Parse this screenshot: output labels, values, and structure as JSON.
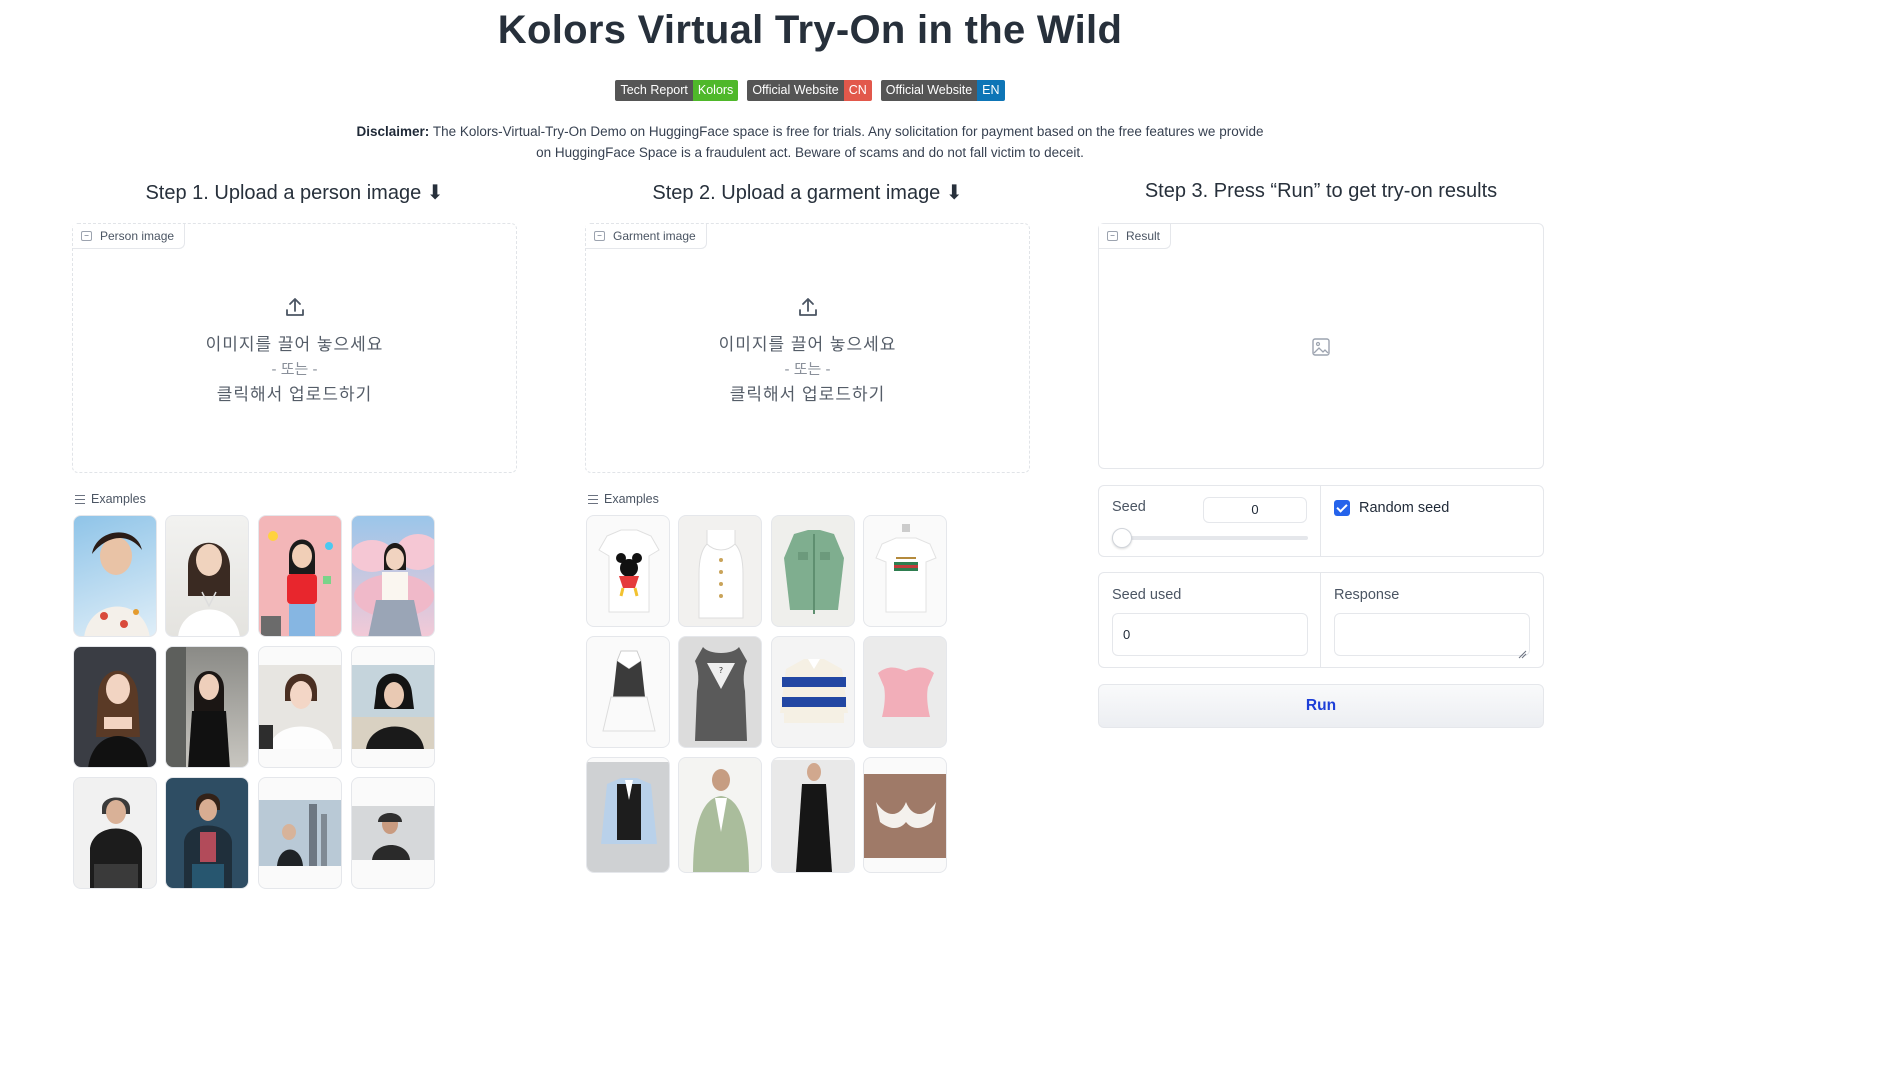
{
  "title": "Kolors Virtual Try-On in the Wild",
  "badges": [
    {
      "left": "Tech Report",
      "right": "Kolors",
      "color": "#4fb82a"
    },
    {
      "left": "Official Website",
      "right": "CN",
      "color": "#e2584b"
    },
    {
      "left": "Official Website",
      "right": "EN",
      "color": "#0e75b6"
    }
  ],
  "disclaimer": {
    "bold": "Disclaimer:",
    "line1": " The Kolors-Virtual-Try-On Demo on HuggingFace space is free for trials. Any solicitation for payment based on the free features we provide",
    "line2": "on HuggingFace Space is a fraudulent act. Beware of scams and do not fall victim to deceit."
  },
  "steps": {
    "step1": "Step 1. Upload a person image ⬇",
    "step2": "Step 2. Upload a garment image ⬇",
    "step3": "Step 3. Press “Run” to get try-on results"
  },
  "person": {
    "label": "Person image",
    "drop_line1": "이미지를 끌어 놓으세요",
    "drop_line2": "- 또는 -",
    "drop_line3": "클릭해서 업로드하기",
    "examples_label": "Examples"
  },
  "garment": {
    "label": "Garment image",
    "drop_line1": "이미지를 끌어 놓으세요",
    "drop_line2": "- 또는 -",
    "drop_line3": "클릭해서 업로드하기",
    "examples_label": "Examples"
  },
  "result": {
    "label": "Result"
  },
  "controls": {
    "seed_label": "Seed",
    "seed_value": "0",
    "random_seed_label": "Random seed",
    "random_seed_checked": true,
    "seed_used_label": "Seed used",
    "seed_used_value": "0",
    "response_label": "Response",
    "response_value": "",
    "run_label": "Run"
  },
  "colors": {
    "accent": "#2563eb",
    "run_text": "#1d3fd8"
  }
}
